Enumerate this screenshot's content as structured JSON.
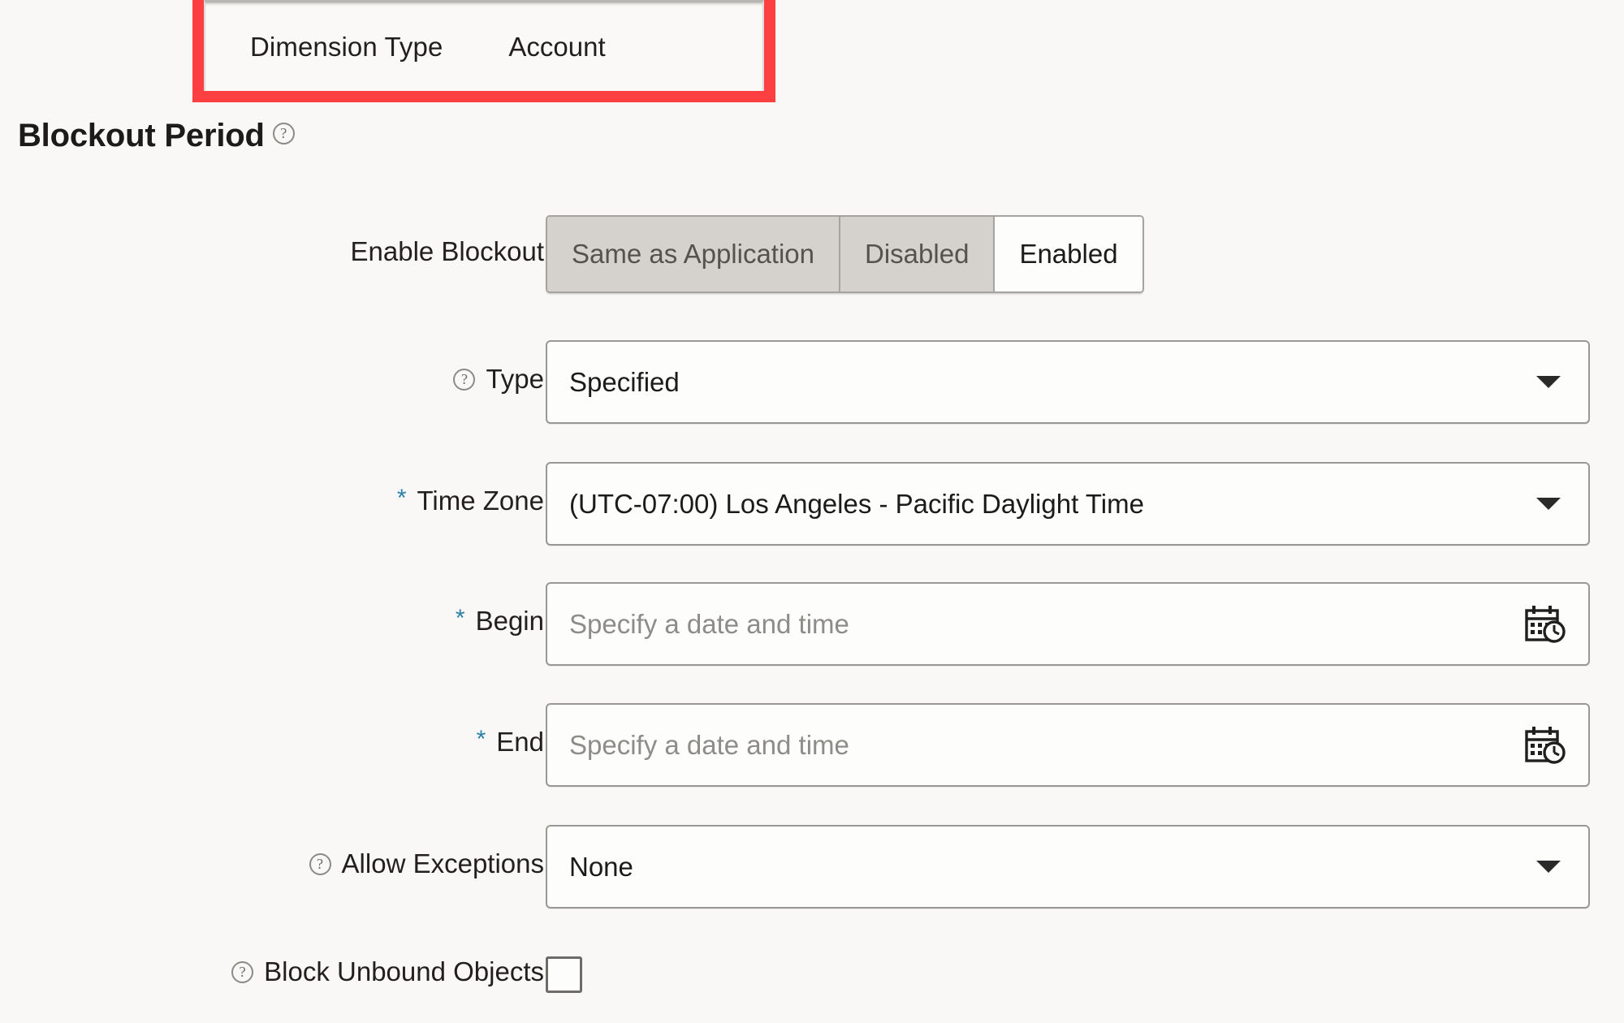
{
  "highlight": {
    "color": "#fc4042",
    "dimension_type_label": "Dimension Type",
    "dimension_type_value": "Account"
  },
  "section": {
    "title": "Blockout Period",
    "help_icon": "help-circle-icon"
  },
  "form": {
    "enable_blockout": {
      "label": "Enable Blockout",
      "options": [
        {
          "label": "Same as Application",
          "selected": false
        },
        {
          "label": "Disabled",
          "selected": false
        },
        {
          "label": "Enabled",
          "selected": true
        }
      ]
    },
    "type": {
      "label": "Type",
      "help_icon": "help-circle-icon",
      "value": "Specified",
      "control": "dropdown",
      "caret_icon": "chevron-down-icon"
    },
    "time_zone": {
      "label": "Time Zone",
      "required": true,
      "required_marker": "*",
      "required_color": "#2b7fa8",
      "value": "(UTC-07:00) Los Angeles - Pacific Daylight Time",
      "control": "dropdown",
      "caret_icon": "chevron-down-icon"
    },
    "begin": {
      "label": "Begin",
      "required": true,
      "required_marker": "*",
      "value": "",
      "placeholder": "Specify a date and time",
      "control": "datetime",
      "trigger_icon": "calendar-clock-icon"
    },
    "end": {
      "label": "End",
      "required": true,
      "required_marker": "*",
      "value": "",
      "placeholder": "Specify a date and time",
      "control": "datetime",
      "trigger_icon": "calendar-clock-icon"
    },
    "allow_exceptions": {
      "label": "Allow Exceptions",
      "help_icon": "help-circle-icon",
      "value": "None",
      "control": "dropdown",
      "caret_icon": "chevron-down-icon"
    },
    "block_unbound_objects": {
      "label": "Block Unbound Objects",
      "help_icon": "help-circle-icon",
      "checked": false,
      "control": "checkbox"
    }
  }
}
